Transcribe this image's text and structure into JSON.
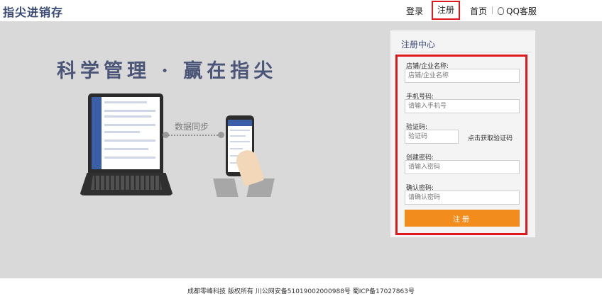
{
  "header": {
    "logo_text": "指尖进销存",
    "nav": {
      "login": "登录",
      "register": "注册",
      "home": "首页",
      "qq": "QQ客服"
    }
  },
  "hero": {
    "slogan": "科学管理 · 赢在指尖",
    "sync_label": "数据同步"
  },
  "register_panel": {
    "title": "注册中心",
    "fields": [
      {
        "label": "店铺/企业名称:",
        "placeholder": "店铺/企业名称",
        "value": ""
      },
      {
        "label": "手机号码:",
        "placeholder": "请输入手机号",
        "value": ""
      },
      {
        "label": "验证码:",
        "placeholder": "验证码",
        "value": ""
      },
      {
        "label": "创建密码:",
        "placeholder": "请输入密码",
        "value": ""
      },
      {
        "label": "确认密码:",
        "placeholder": "请确认密码",
        "value": ""
      }
    ],
    "get_code": "点击获取验证码",
    "submit_label": "注册"
  },
  "footer": {
    "text": "成都零峰科技 版权所有  川公网安备51019002000988号 蜀ICP备17027863号"
  },
  "colors": {
    "brand_navy": "#3a4a76",
    "accent_orange": "#f28c1c",
    "highlight_red": "#e0181e",
    "hero_bg": "#d9d9d9"
  }
}
